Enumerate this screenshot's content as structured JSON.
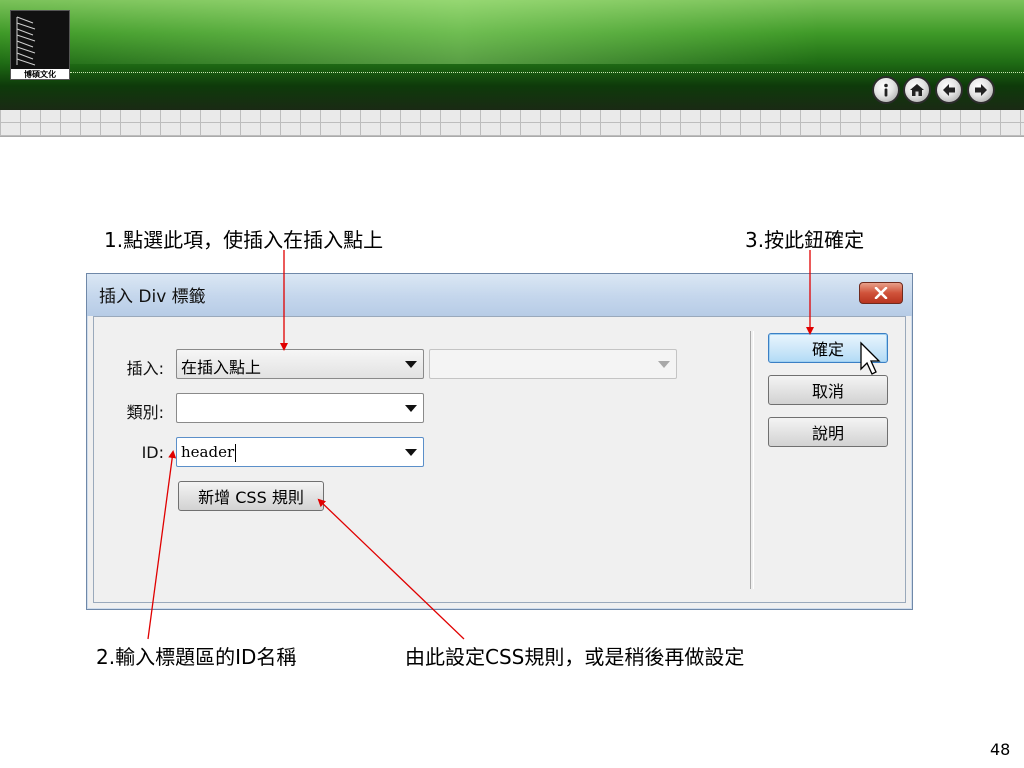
{
  "logo": {
    "text": "博碩文化"
  },
  "nav_buttons": [
    {
      "icon": "info-icon"
    },
    {
      "icon": "home-icon"
    },
    {
      "icon": "back-arrow-icon"
    },
    {
      "icon": "forward-arrow-icon"
    }
  ],
  "callouts": {
    "c1": "1.點選此項，使插入在插入點上",
    "c2": "2.輸入標題區的ID名稱",
    "c3": "3.按此鈕確定",
    "c4": "由此設定CSS規則，或是稍後再做設定"
  },
  "dialog": {
    "title": "插入 Div 標籤",
    "fields": {
      "insert_label": "插入:",
      "insert_value": "在插入點上",
      "insert_secondary_value": "",
      "class_label": "類別:",
      "class_value": "",
      "id_label": "ID:",
      "id_value": "header"
    },
    "new_css_rule_button": "新增 CSS 規則",
    "ok_button": "確定",
    "cancel_button": "取消",
    "help_button": "說明"
  },
  "page_number": "48",
  "colors": {
    "banner_green": "#1e6a14",
    "annotation_red": "#e00000",
    "default_button_blue": "#3b7fc4"
  }
}
